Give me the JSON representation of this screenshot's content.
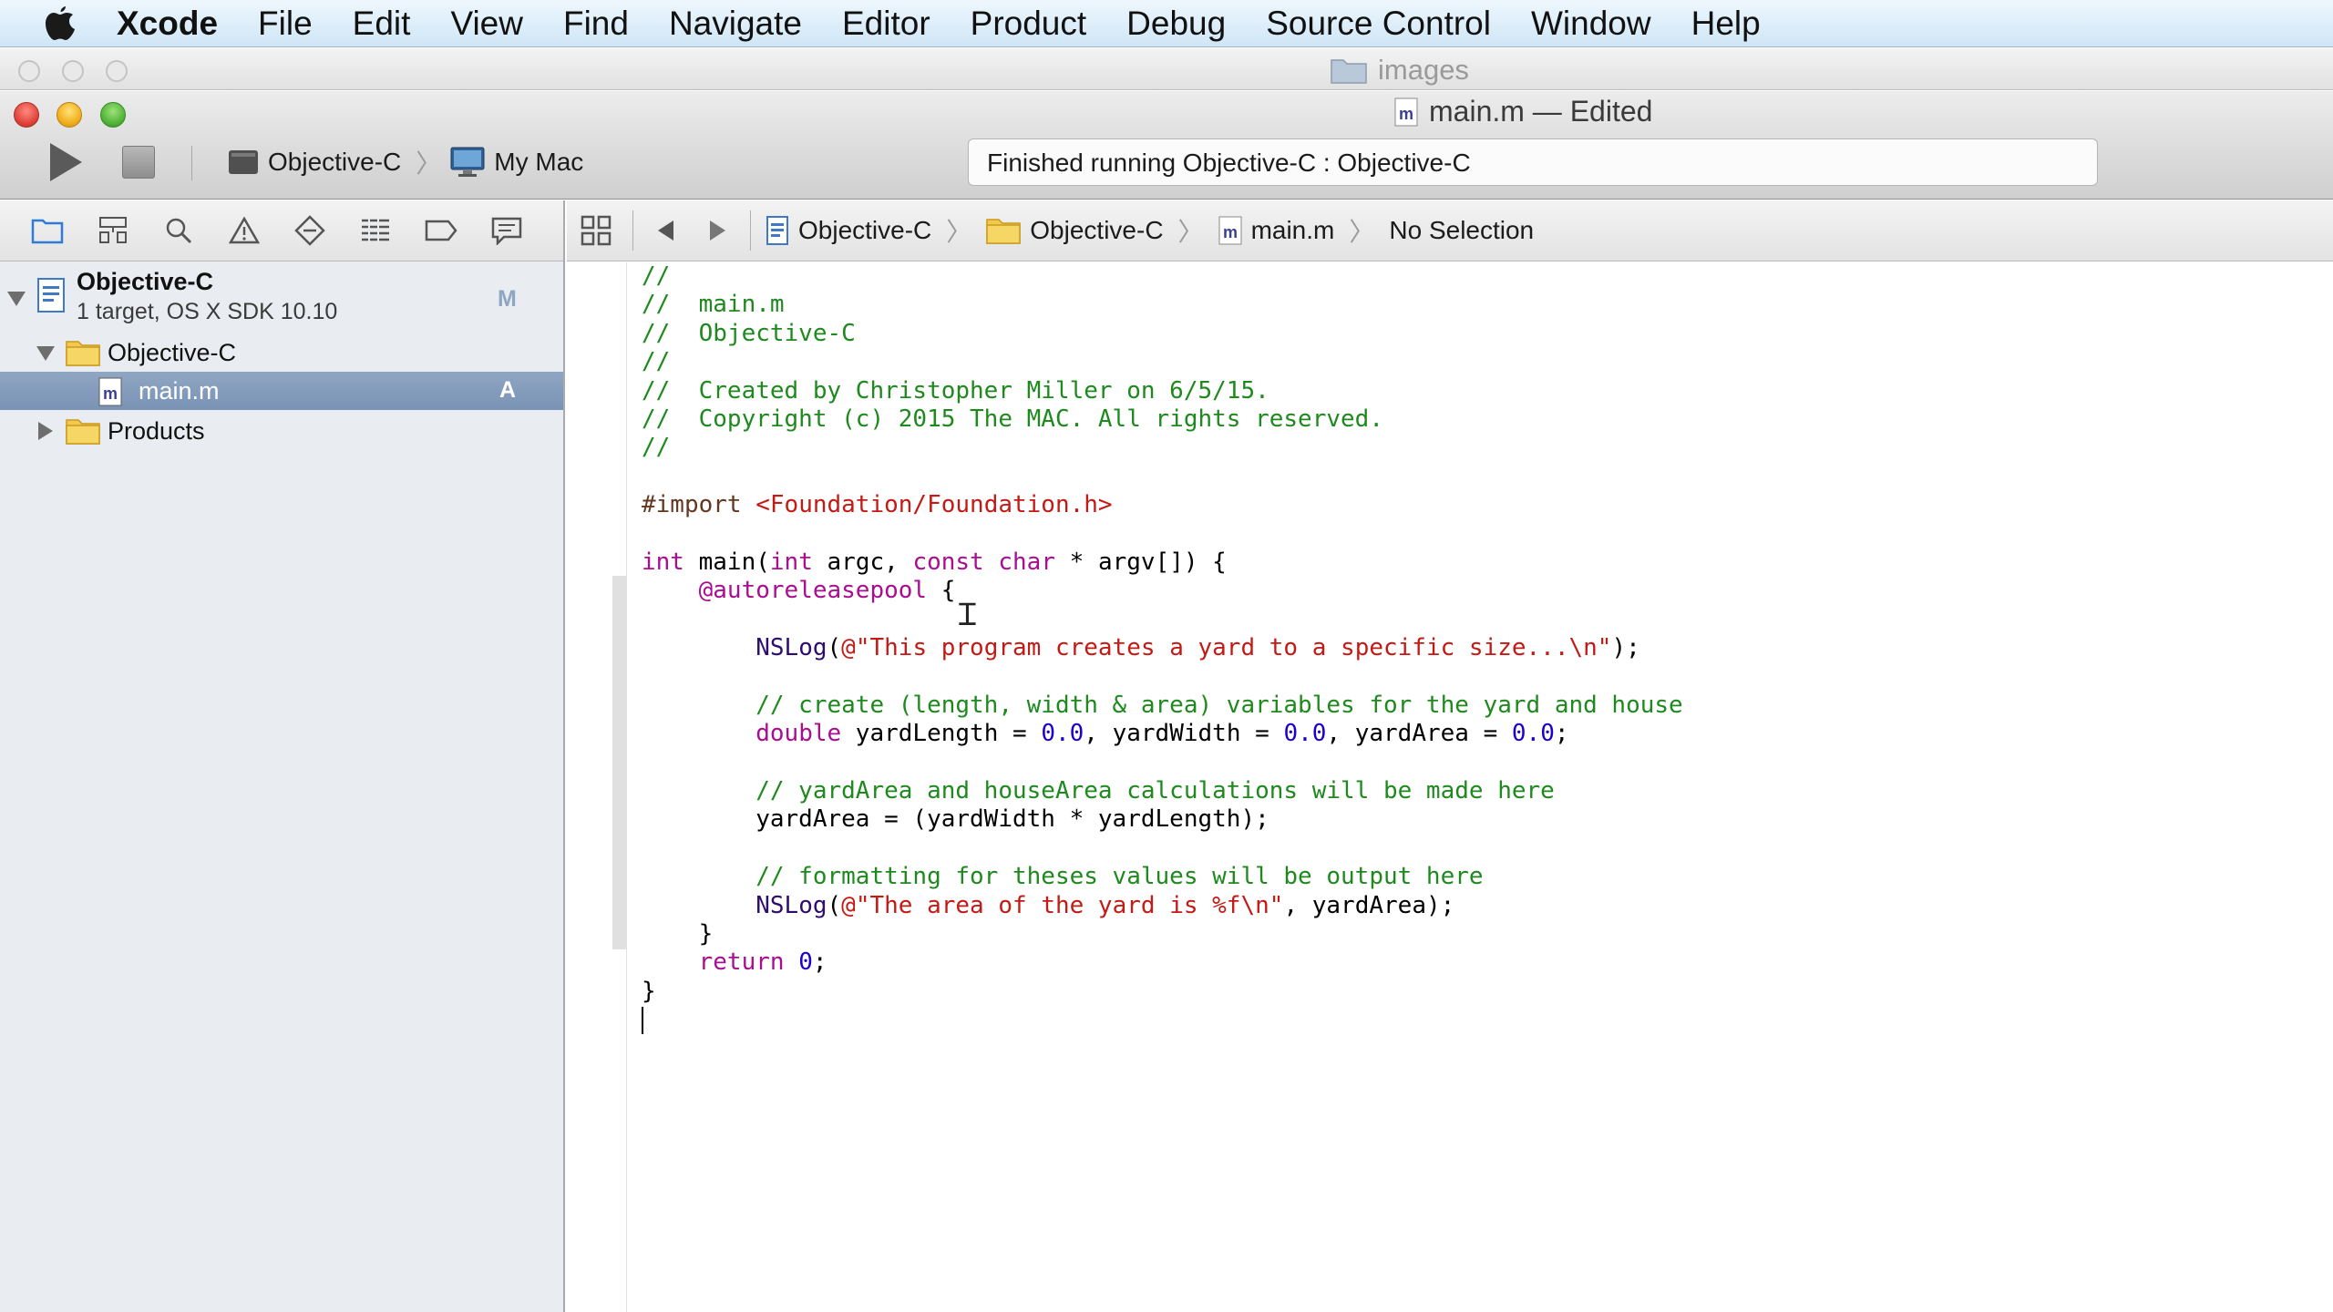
{
  "menubar": {
    "app_name": "Xcode",
    "items": [
      "File",
      "Edit",
      "View",
      "Find",
      "Navigate",
      "Editor",
      "Product",
      "Debug",
      "Source Control",
      "Window",
      "Help"
    ]
  },
  "background_window": {
    "title": "images"
  },
  "window": {
    "title": "main.m — Edited",
    "scheme": "Objective-C",
    "destination": "My Mac",
    "status": "Finished running Objective-C : Objective-C"
  },
  "navigator": {
    "project": {
      "name": "Objective-C",
      "subtitle": "1 target, OS X SDK 10.10",
      "badge": "M"
    },
    "group": {
      "name": "Objective-C"
    },
    "file": {
      "name": "main.m",
      "badge": "A"
    },
    "products": {
      "name": "Products"
    }
  },
  "jumpbar": {
    "crumbs": [
      "Objective-C",
      "Objective-C",
      "main.m",
      "No Selection"
    ]
  },
  "editor": {
    "code_lines": [
      "//",
      "//  main.m",
      "//  Objective-C",
      "//",
      "//  Created by Christopher Miller on 6/5/15.",
      "//  Copyright (c) 2015 The MAC. All rights reserved.",
      "//",
      "",
      "#import <Foundation/Foundation.h>",
      "",
      "int main(int argc, const char * argv[]) {",
      "    @autoreleasepool {",
      "",
      "        NSLog(@\"This program creates a yard to a specific size...\\n\");",
      "",
      "        // create (length, width & area) variables for the yard and house",
      "        double yardLength = 0.0, yardWidth = 0.0, yardArea = 0.0;",
      "",
      "        // yardArea and houseArea calculations will be made here",
      "        yardArea = (yardWidth * yardLength);",
      "",
      "        // formatting for theses values will be output here",
      "        NSLog(@\"The area of the yard is %f\\n\", yardArea);",
      "    }",
      "    return 0;",
      "}",
      ""
    ]
  },
  "colors": {
    "comment": "#1e8a1e",
    "keyword": "#aa0d91",
    "string": "#c41a16",
    "number": "#1c00cf",
    "selection": "#7a93b5"
  }
}
